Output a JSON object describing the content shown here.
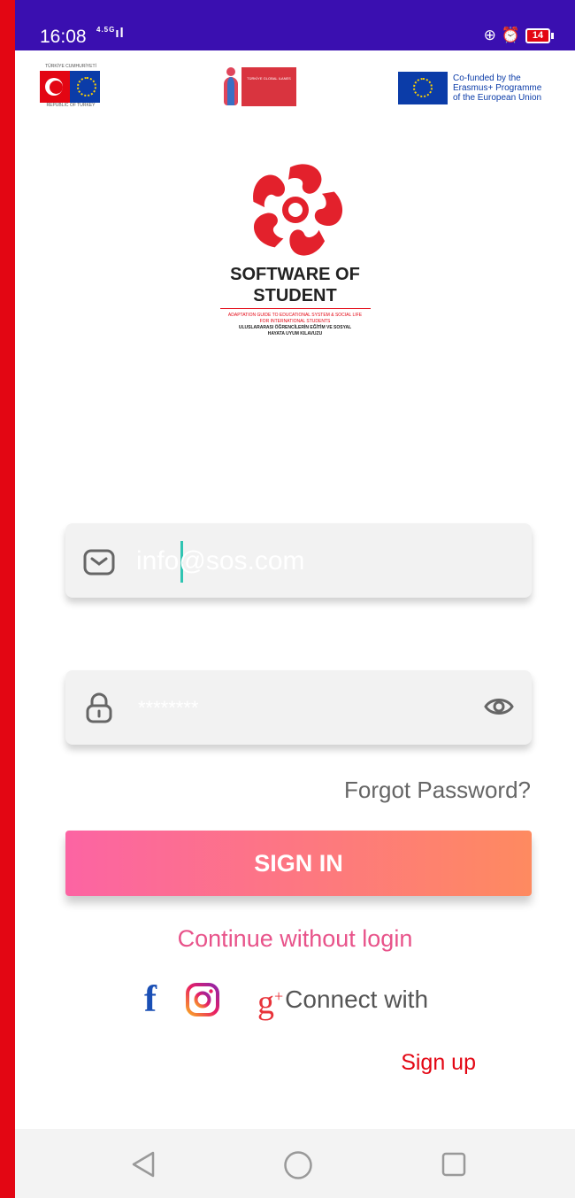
{
  "status_bar": {
    "time": "16:08",
    "network": "4.5G",
    "battery": "14"
  },
  "logos": {
    "turkey_top": "TÜRKİYE CUMHURİYETİ",
    "turkey_bottom": "REPUBLIC OF TURKEY",
    "tg_text": "TÜRKİYE GLOBAL ILANES",
    "eu_text": [
      "Co-funded by the",
      "Erasmus+ Programme",
      "of the European Union"
    ]
  },
  "brand": {
    "title_line1": "SOFTWARE OF",
    "title_line2": "STUDENT",
    "subtitle1": "ADAPTATION GUIDE TO EDUCATIONAL SYSTEM & SOCIAL LIFE FOR INTERNATIONAL STUDENTS",
    "subtitle2": "ULUSLARARASI ÖĞRENCİLERİN EĞİTİM VE SOSYAL HAYATA UYUM KILAVUZU"
  },
  "form": {
    "email_placeholder": "info@sos.com",
    "password_placeholder": "********",
    "forgot_password": "Forgot Password?",
    "sign_in": "SIGN IN",
    "continue_without_login": "Continue without login",
    "connect_with": "Connect with",
    "sign_up": "Sign up"
  },
  "social": [
    "facebook",
    "instagram",
    "google-plus"
  ],
  "colors": {
    "status_bar": "#3a0fb0",
    "frame": "#e30613",
    "gradient_start": "#fc64a3",
    "gradient_end": "#fe8a60",
    "accent_pink": "#e8538a"
  }
}
